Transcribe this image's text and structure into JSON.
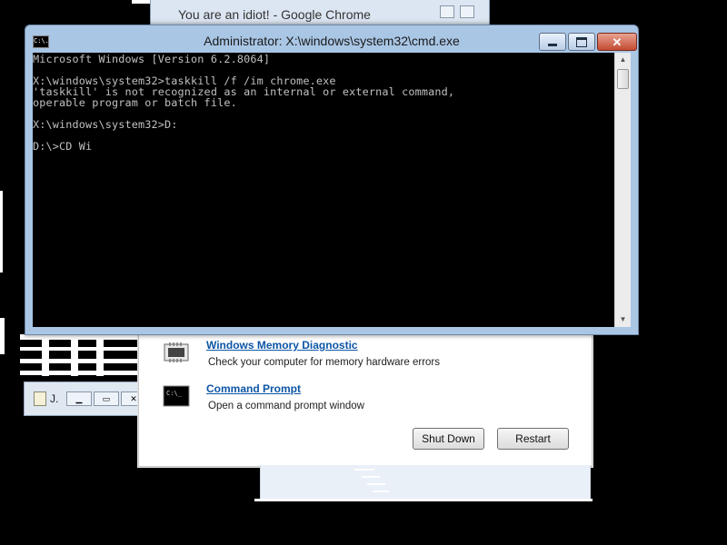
{
  "chrome_window": {
    "title": "You are an idiot! - Google Chrome"
  },
  "cmd_window": {
    "title": "Administrator: X:\\windows\\system32\\cmd.exe",
    "icon_text": "C:\\.",
    "console_lines": [
      "Microsoft Windows [Version 6.2.8064]",
      "",
      "X:\\windows\\system32>taskkill /f /im chrome.exe",
      "'taskkill' is not recognized as an internal or external command,",
      "operable program or batch file.",
      "",
      "X:\\windows\\system32>D:",
      "",
      "D:\\>CD Wi"
    ],
    "minimize_icon": "minimize-icon",
    "maximize_icon": "maximize-icon",
    "close_label": "✕"
  },
  "recovery_dialog": {
    "items": [
      {
        "title": "Windows Memory Diagnostic",
        "description": "Check your computer for memory hardware errors",
        "icon": "memory-chip-icon"
      },
      {
        "title": "Command Prompt",
        "description": "Open a command prompt window",
        "icon": "command-prompt-icon"
      }
    ],
    "shutdown_label": "Shut Down",
    "restart_label": "Restart"
  },
  "mini_window": {
    "label": "J."
  }
}
